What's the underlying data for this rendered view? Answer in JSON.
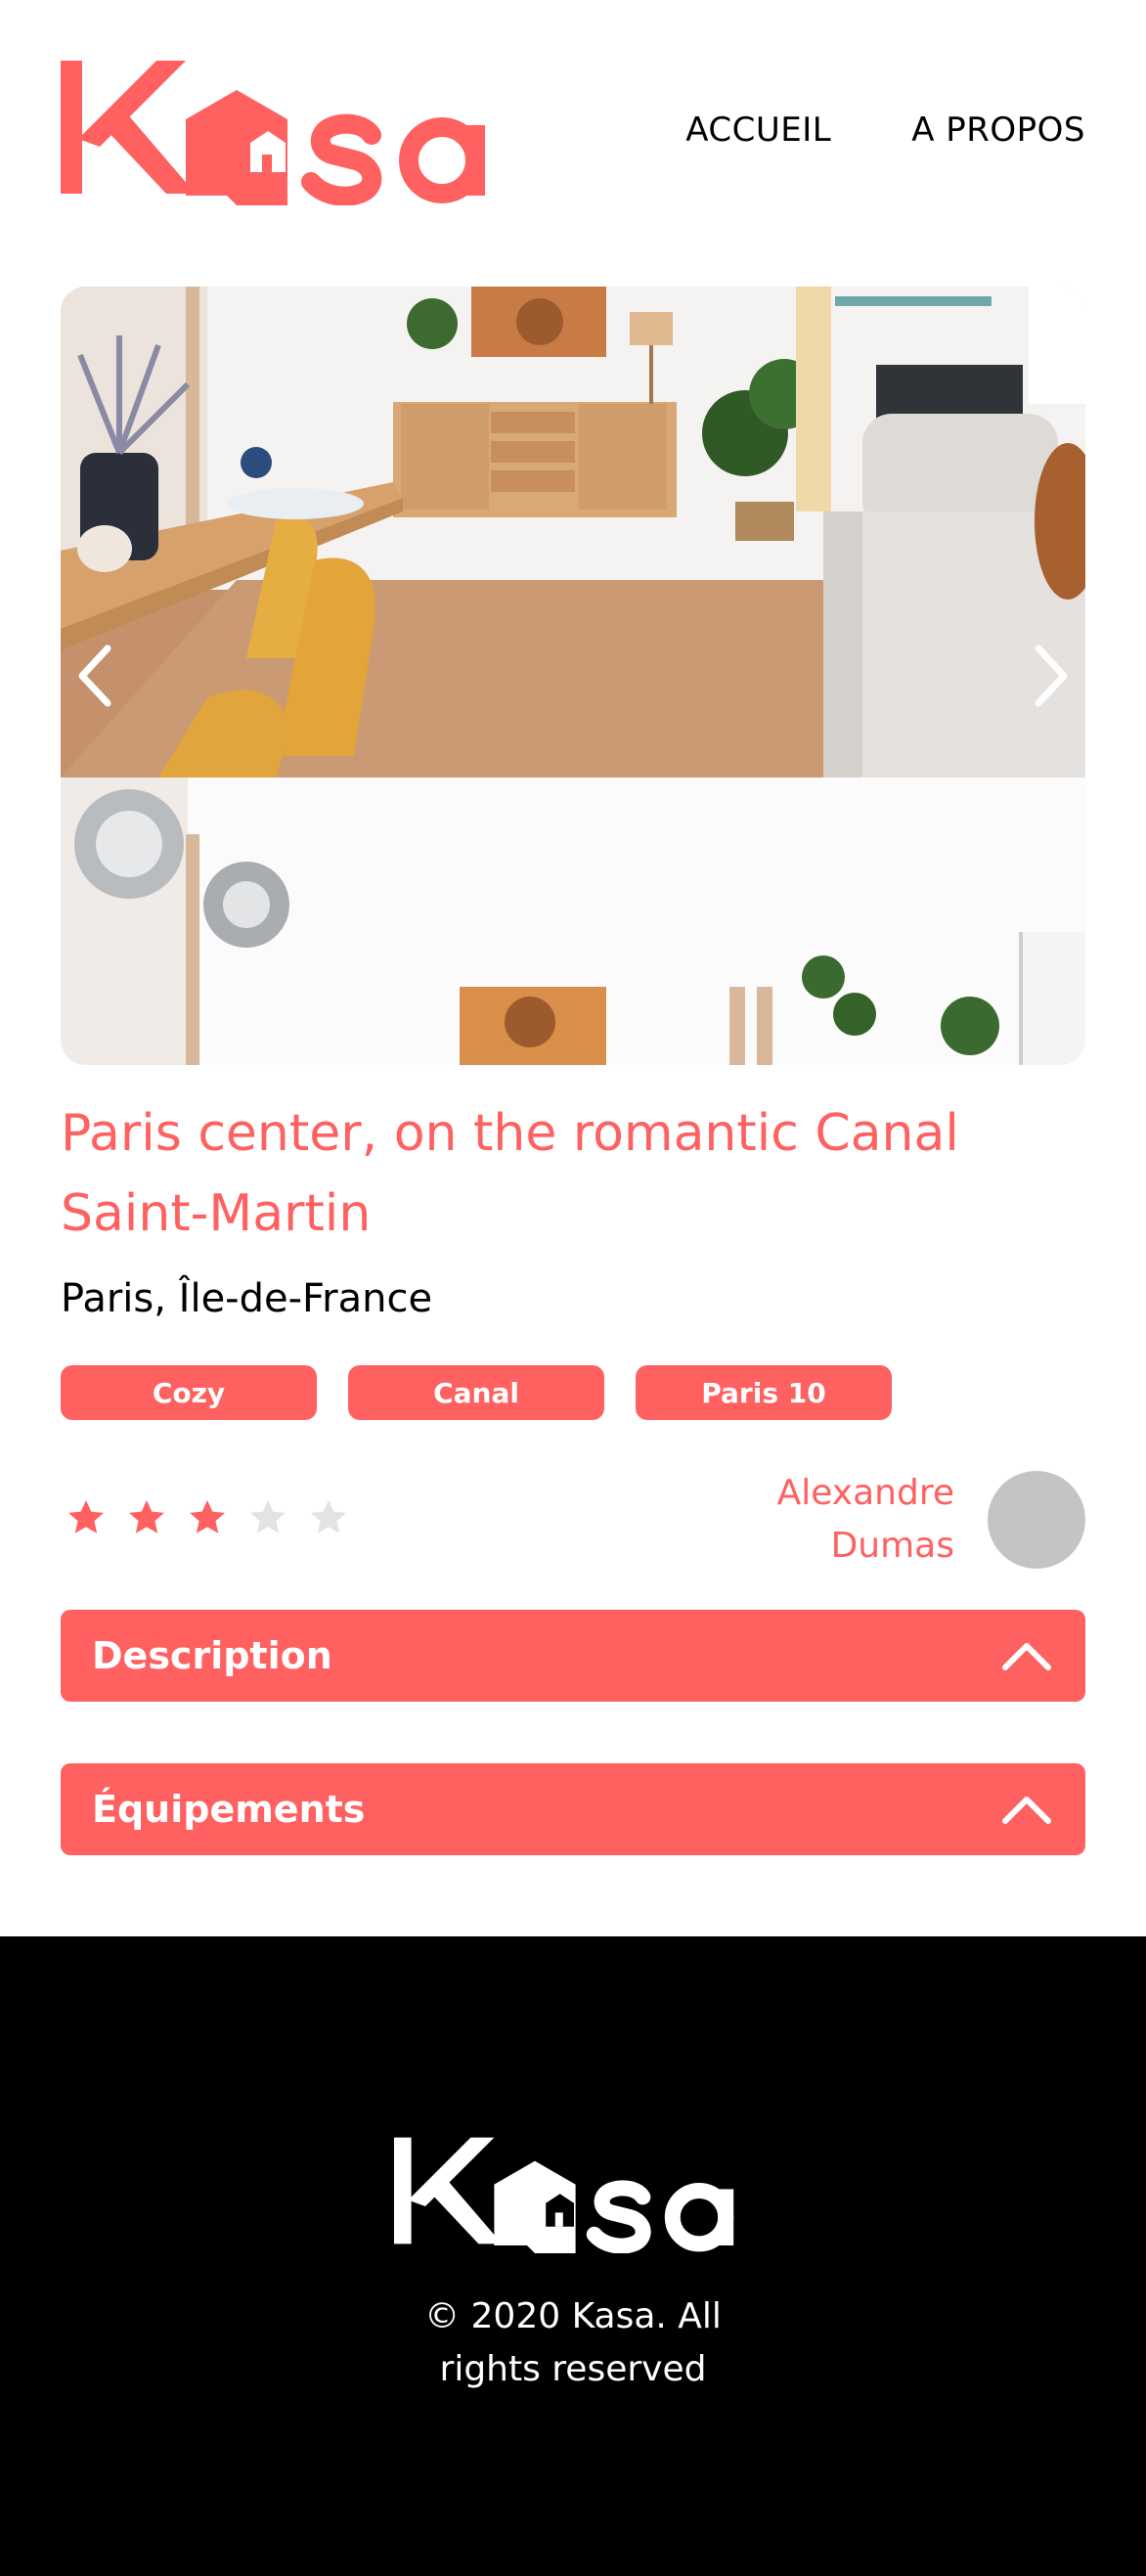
{
  "brand": {
    "name": "Kasa",
    "accent_color": "#FF6060",
    "logo_icon": "house-icon"
  },
  "nav": {
    "items": [
      {
        "label": "ACCUEIL"
      },
      {
        "label": "A PROPOS"
      }
    ]
  },
  "carousel": {
    "prev_icon": "chevron-left-icon",
    "next_icon": "chevron-right-icon"
  },
  "listing": {
    "title": "Paris center, on the romantic Canal Saint-Martin",
    "location": "Paris, Île-de-France",
    "tags": [
      "Cozy",
      "Canal",
      "Paris 10"
    ],
    "rating": 3,
    "rating_max": 5,
    "host": {
      "first_name": "Alexandre",
      "last_name": "Dumas"
    }
  },
  "sections": {
    "description": {
      "label": "Description",
      "icon": "chevron-up-icon"
    },
    "equipment": {
      "label": "Équipements",
      "icon": "chevron-up-icon"
    }
  },
  "footer": {
    "copyright_line1": "© 2020 Kasa. All",
    "copyright_line2": "rights reserved"
  }
}
